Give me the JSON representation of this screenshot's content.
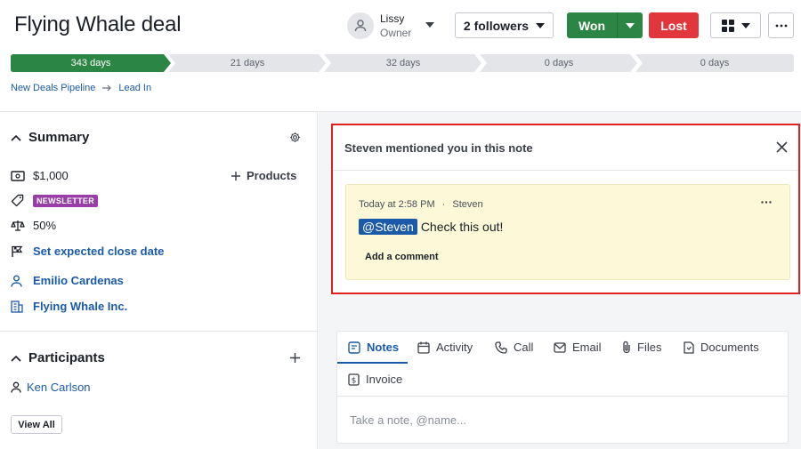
{
  "deal": {
    "title": "Flying Whale deal",
    "owner_name": "Lissy",
    "owner_role": "Owner",
    "followers_label": "2 followers",
    "won_label": "Won",
    "lost_label": "Lost"
  },
  "pipeline": {
    "stages": [
      "343 days",
      "21 days",
      "32 days",
      "0 days",
      "0 days"
    ],
    "active_index": 0,
    "active_color": "#2b8645"
  },
  "breadcrumb": {
    "pipeline": "New Deals Pipeline",
    "stage": "Lead In"
  },
  "summary": {
    "heading": "Summary",
    "value": "$1,000",
    "products_label": "Products",
    "label_badge": "NEWSLETTER",
    "probability": "50%",
    "close_date_link": "Set expected close date",
    "person": "Emilio Cardenas",
    "organization": "Flying Whale Inc."
  },
  "participants": {
    "heading": "Participants",
    "items": [
      "Ken Carlson"
    ],
    "view_all_label": "View All"
  },
  "notification": {
    "header": "Steven mentioned you in this note",
    "meta_time": "Today at 2:58 PM",
    "meta_sep": "·",
    "meta_author": "Steven",
    "mention": "@Steven",
    "body": "Check this out!",
    "add_comment": "Add a comment"
  },
  "tabs": {
    "items": [
      "Notes",
      "Activity",
      "Call",
      "Email",
      "Files",
      "Documents",
      "Invoice"
    ],
    "active": "Notes",
    "note_placeholder": "Take a note, @name..."
  },
  "colors": {
    "accent": "#1a5aa8",
    "won": "#2b8645",
    "lost": "#e1373c",
    "highlight_border": "#e02020",
    "badge": "#9a3ea7",
    "note_bg": "#fdf8d7"
  }
}
